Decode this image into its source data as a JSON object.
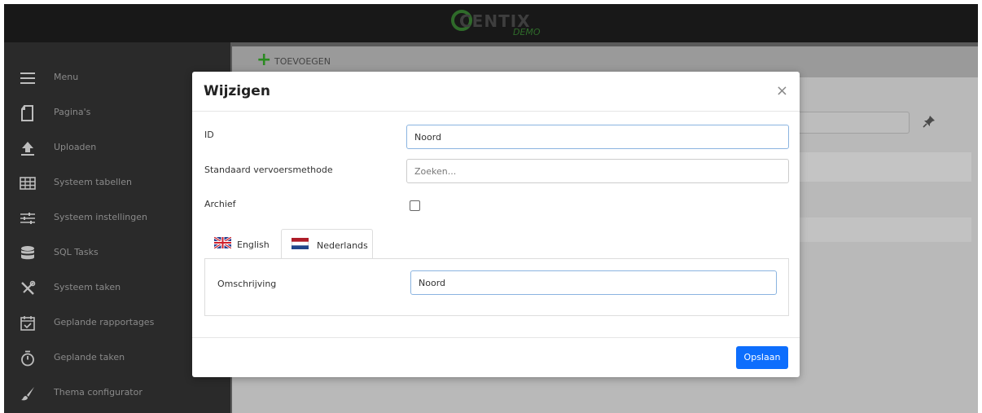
{
  "logo": {
    "word": "CENTIX",
    "sub": "DEMO",
    "colors": {
      "ring": "#2f6b2a",
      "word": "#3e3e3e"
    }
  },
  "sidebar": {
    "items": [
      {
        "label": "Menu",
        "icon": "hamburger-icon"
      },
      {
        "label": "Pagina's",
        "icon": "page-icon"
      },
      {
        "label": "Uploaden",
        "icon": "upload-icon"
      },
      {
        "label": "Systeem tabellen",
        "icon": "table-icon"
      },
      {
        "label": "Systeem instellingen",
        "icon": "sliders-icon"
      },
      {
        "label": "SQL Tasks",
        "icon": "database-icon"
      },
      {
        "label": "Systeem taken",
        "icon": "tools-icon"
      },
      {
        "label": "Geplande rapportages",
        "icon": "calendar-check-icon"
      },
      {
        "label": "Geplande taken",
        "icon": "stopwatch-icon"
      },
      {
        "label": "Thema configurator",
        "icon": "brush-icon"
      }
    ]
  },
  "toolbar": {
    "add_label": "TOEVOEGEN",
    "add_color": "#2a8a20"
  },
  "modal": {
    "title": "Wijzigen",
    "close_glyph": "×",
    "fields": {
      "id": {
        "label": "ID",
        "value": "Noord"
      },
      "transport": {
        "label": "Standaard vervoersmethode",
        "placeholder": "Zoeken..."
      },
      "archive": {
        "label": "Archief",
        "checked": false
      }
    },
    "tabs": [
      {
        "label": "English",
        "flag": "uk-flag-icon",
        "active": false
      },
      {
        "label": "Nederlands",
        "flag": "nl-flag-icon",
        "active": true
      }
    ],
    "description": {
      "label": "Omschrijving",
      "value": "Noord"
    },
    "save_label": "Opslaan",
    "save_color": "#0d6efd"
  }
}
